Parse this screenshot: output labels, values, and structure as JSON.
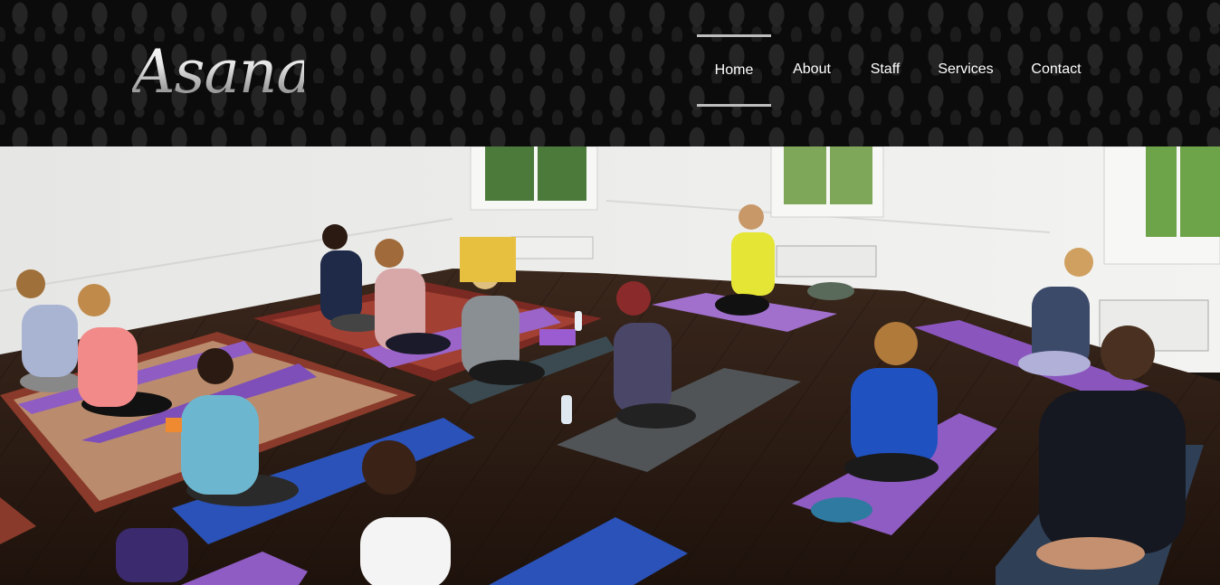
{
  "brand": {
    "logo_text": "Asana"
  },
  "nav": {
    "items": [
      {
        "label": "Home",
        "active": true
      },
      {
        "label": "About",
        "active": false
      },
      {
        "label": "Staff",
        "active": false
      },
      {
        "label": "Services",
        "active": false
      },
      {
        "label": "Contact",
        "active": false
      }
    ]
  },
  "colors": {
    "header_bg": "#0b0b0b",
    "nav_text": "#ffffff",
    "nav_active_border": "#bdbdbd",
    "floor": "#2b1a12",
    "wall": "#eeeeec",
    "mat_purple": "#8e5cc2",
    "mat_blue": "#2a52b8",
    "mat_gray": "#4a4f52"
  },
  "hero": {
    "icon": "yoga-class-photo"
  }
}
